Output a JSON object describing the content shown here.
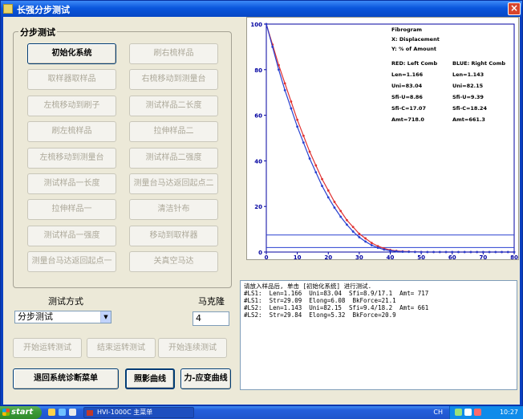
{
  "window": {
    "title": "长强分步测试"
  },
  "group": {
    "label": "分步测试",
    "buttons": [
      "初始化系统",
      "刷右梳样品",
      "取样器取样品",
      "右梳移动到测量台",
      "左梳移动到刷子",
      "测试样品二长度",
      "刷左梳样品",
      "拉伸样品二",
      "左梳移动到测量台",
      "测试样品二强度",
      "测试样品一长度",
      "测量台马达返回起点二",
      "拉伸样品一",
      "清洁针布",
      "测试样品一强度",
      "移动到取样器",
      "测量台马达返回起点一",
      "关真空马达"
    ]
  },
  "mode": {
    "label": "测试方式",
    "selected": "分步测试"
  },
  "speed": {
    "label": "马克隆",
    "value": "4"
  },
  "run_buttons": {
    "start_run": "开始运转测试",
    "stop_run": "结束运转测试",
    "start_continuous": "开始连续测试"
  },
  "bottom_buttons": {
    "back": "退回系统诊断菜单",
    "photo": "照影曲线",
    "force": "力-应变曲线"
  },
  "log": [
    "请放入样品后, 单击 [初始化系统] 进行测试.",
    "#LS1:  Len=1.166  Uni=83.04  Sfi=8.9/17.1  Amt= 717",
    "#LS1:  Str=29.09  Elong=6.08  BkForce=21.1",
    "#LS2:  Len=1.143  Uni=82.15  Sfi=9.4/18.2  Amt= 661",
    "#LS2:  Str=29.84  Elong=5.32  BkForce=20.9"
  ],
  "chart_data": {
    "type": "line",
    "x_ticks": [
      "0",
      "10",
      "20",
      "30",
      "40",
      "50",
      "60",
      "70",
      "80"
    ],
    "y_ticks": [
      "0",
      "20",
      "40",
      "60",
      "80",
      "100"
    ],
    "xlim": [
      0,
      80
    ],
    "ylim": [
      0,
      100
    ],
    "annotation": {
      "title": "Fibrogram",
      "x_desc": "X: Displacement",
      "y_desc": "Y: % of Amount",
      "red_head": "RED: Left Comb",
      "blue_head": "BLUE: Right Comb",
      "red_stats": [
        "Len=1.166",
        "Uni=83.04",
        "Sfi-U=8.86",
        "Sfi-C=17.07",
        "Amt=718.0"
      ],
      "blue_stats": [
        "Len=1.143",
        "Uni=82.15",
        "Sfi-U=9.39",
        "Sfi-C=18.24",
        "Amt=661.3"
      ]
    },
    "series": [
      {
        "color": "#e03030",
        "x": [
          0,
          2,
          4,
          6,
          8,
          10,
          12,
          14,
          16,
          18,
          20,
          22,
          24,
          26,
          28,
          30,
          32,
          34,
          36,
          38,
          40,
          42,
          44,
          46,
          48,
          50,
          52,
          54,
          56,
          58,
          60,
          62,
          64,
          66,
          68,
          70,
          72,
          74,
          76,
          78,
          80
        ],
        "y": [
          100,
          91,
          82,
          74,
          66,
          58,
          51,
          44,
          38,
          32,
          27,
          22,
          18,
          14,
          11,
          8,
          6,
          4,
          2.6,
          1.6,
          0.9,
          0.5,
          0.3,
          0.2,
          0.1,
          0.05,
          0,
          0,
          0,
          0,
          0,
          0,
          0,
          0,
          0,
          0,
          0,
          0,
          0,
          0,
          0
        ]
      },
      {
        "color": "#2840d0",
        "x": [
          0,
          2,
          4,
          6,
          8,
          10,
          12,
          14,
          16,
          18,
          20,
          22,
          24,
          26,
          28,
          30,
          32,
          34,
          36,
          38,
          40,
          42,
          44,
          46,
          48,
          50,
          52,
          54,
          56,
          58,
          60,
          62,
          64,
          66,
          68,
          70,
          72,
          74,
          76,
          78,
          80
        ],
        "y": [
          100,
          90,
          80,
          71,
          63,
          55,
          48,
          41,
          35,
          29,
          24,
          19.5,
          15.5,
          12,
          9,
          6.5,
          4.6,
          3,
          1.9,
          1.1,
          0.6,
          0.3,
          0.15,
          0.08,
          0.04,
          0,
          0,
          0,
          0,
          0,
          0,
          0,
          0,
          0,
          0,
          0,
          0,
          0,
          0,
          0,
          0
        ]
      }
    ],
    "hlines": [
      {
        "y": 7.5,
        "color": "#2840d0"
      },
      {
        "y": 2,
        "color": "#2840d0"
      }
    ],
    "grid": false,
    "colors": {
      "axis": "#0000a0",
      "tick_text": "#0000a0"
    }
  },
  "taskbar": {
    "start": "start",
    "task": "HVI-1000C 主菜单",
    "lang": "CH",
    "time": "10:27"
  }
}
